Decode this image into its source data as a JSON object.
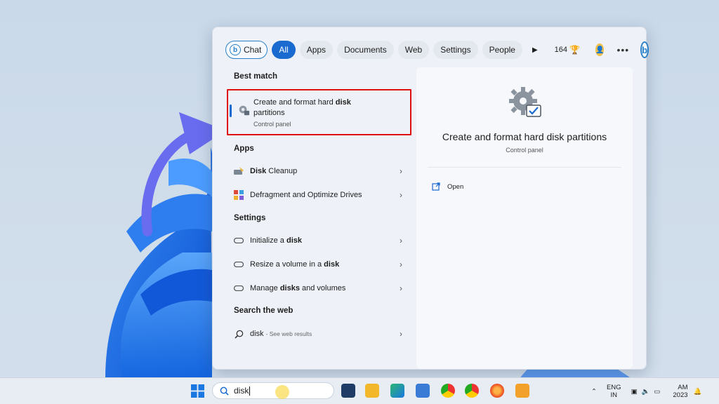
{
  "filters": {
    "chat": "Chat",
    "chat_icon_letter": "b",
    "all": "All",
    "apps": "Apps",
    "documents": "Documents",
    "web": "Web",
    "settings": "Settings",
    "people": "People",
    "points": "164",
    "bing_letter": "b"
  },
  "sections": {
    "best_match": "Best match",
    "apps": "Apps",
    "settings": "Settings",
    "search_web": "Search the web"
  },
  "best_match": {
    "title_prefix": "Create and format hard ",
    "title_bold": "disk",
    "title_suffix": "partitions",
    "subtitle": "Control panel"
  },
  "apps": [
    {
      "bold": "Disk",
      "rest": " Cleanup"
    },
    {
      "pre": "Defragment and Optimize Drives"
    }
  ],
  "settings_items": [
    {
      "pre": "Initialize a ",
      "bold": "disk"
    },
    {
      "pre": "Resize a volume in a ",
      "bold": "disk"
    },
    {
      "pre": "Manage ",
      "bold": "disks",
      "rest": " and volumes"
    }
  ],
  "web": {
    "query": "disk",
    "hint": "- See web results"
  },
  "preview": {
    "title": "Create and format hard disk partitions",
    "subtitle": "Control panel",
    "open_label": "Open"
  },
  "taskbar": {
    "search_value": "disk",
    "lang_top": "ENG",
    "lang_bottom": "IN",
    "time": "AM",
    "year": "2023"
  },
  "colors": {
    "accent": "#1a6ad0",
    "highlight_box": "#e01010",
    "arrow": "#6a6cf0"
  }
}
